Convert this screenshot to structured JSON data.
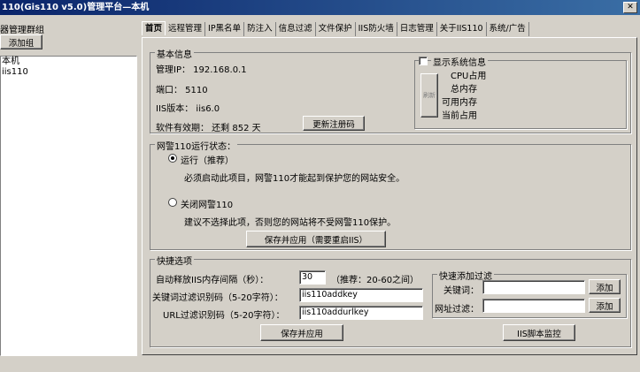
{
  "window": {
    "title": "110(Gis110 v5.0)管理平台—本机"
  },
  "left": {
    "group_label": "器管理群组",
    "add_group_button": "添加组",
    "tree": [
      "本机",
      "iis110"
    ]
  },
  "tabs": [
    "首页",
    "远程管理",
    "IP黑名单",
    "防注入",
    "信息过滤",
    "文件保护",
    "IIS防火墙",
    "日志管理",
    "关于IIS110",
    "系统/广告"
  ],
  "basic_info": {
    "legend": "基本信息",
    "ip": "管理IP：  192.168.0.1",
    "port": "端口：  5110",
    "iis": "IIS版本：  iis6.0",
    "validity": "软件有效期：  还剩 852 天",
    "update_button": "更新注册码"
  },
  "sysinfo": {
    "checkbox_label": "显示系统信息",
    "refresh_button": "刷新",
    "cpu": "CPU占用",
    "total_mem": "总内存",
    "avail_mem": "可用内存",
    "current_use": "当前占用"
  },
  "run_state": {
    "legend": "网警110运行状态：",
    "run_label": "运行（推荐）",
    "run_desc": "必须启动此项目，网警110才能起到保护您的网站安全。",
    "close_label": "关闭网警110",
    "close_desc": "建议不选择此项，否则您的网站将不受网警110保护。",
    "save_apply_button": "保存并应用（需要重启IIS）"
  },
  "quick": {
    "legend": "快捷选项",
    "auto_release_label": "自动释放IIS内存间隔（秒）：",
    "auto_release_value": "30",
    "auto_release_hint": "（推荐：20-60之间）",
    "keyword_code_label": "关键词过滤识别码（5-20字符）：",
    "keyword_code_value": "iis110addkey",
    "url_code_label": "URL过滤识别码（5-20字符）：",
    "url_code_value": "iis110addurlkey",
    "save_apply_button": "保存并应用"
  },
  "quick_filter": {
    "legend": "快速添加过滤",
    "keyword_label": "关键词：",
    "url_label": "网址过滤：",
    "add_button": "添加",
    "add_button2": "添加",
    "iis_script_button": "IIS脚本监控"
  }
}
